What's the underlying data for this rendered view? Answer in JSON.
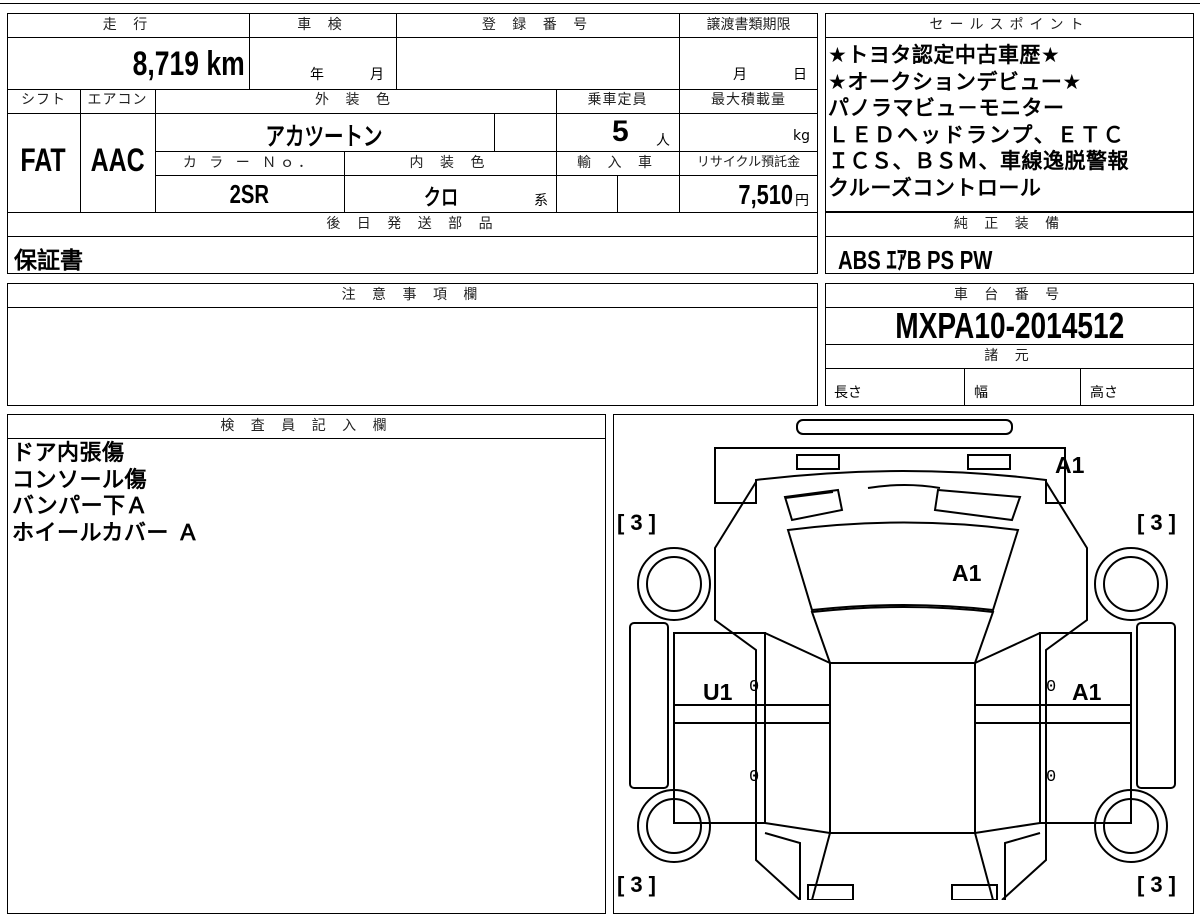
{
  "top_table": {
    "mileage": {
      "header": "走 行",
      "value": "8,719 km"
    },
    "inspection": {
      "header": "車 検",
      "year_unit": "年",
      "month_unit": "月"
    },
    "registration_no": {
      "header": "登 録 番 号"
    },
    "transfer_deadline": {
      "header": "譲渡書類期限",
      "month_unit": "月",
      "day_unit": "日"
    },
    "shift": {
      "header": "シフト",
      "value": "FAT"
    },
    "aircon": {
      "header": "エアコン",
      "value": "AAC"
    },
    "exterior_color": {
      "header": "外 装 色",
      "value": "アカツートン"
    },
    "capacity": {
      "header": "乗車定員",
      "value": "5",
      "unit": "人"
    },
    "max_load": {
      "header": "最大積載量",
      "unit": "kg"
    },
    "color_no": {
      "header": "カ ラ ー Ｎｏ．",
      "value": "2SR"
    },
    "interior_color": {
      "header": "内 装 色",
      "value": "クロ",
      "unit": "系"
    },
    "import": {
      "header": "輸 入 車"
    },
    "recycle_fee": {
      "header": "リサイクル預託金",
      "value": "7,510",
      "unit": "円"
    },
    "later_parts": {
      "header": "後 日 発 送 部 品",
      "value": "保証書"
    }
  },
  "sales_points": {
    "header": "セールスポイント",
    "lines": [
      "★トヨタ認定中古車歴★",
      "★オークションデビュー★",
      "パノラマビュ－モニター",
      "ＬＥＤヘッドランプ、ＥＴＣ",
      "ＩＣＳ、ＢＳＭ、車線逸脱警報",
      "クルーズコントロール"
    ]
  },
  "genuine_equipment": {
    "header": "純 正 装 備",
    "value": "ABS ｴｱB PS PW"
  },
  "notes": {
    "header": "注 意 事 項 欄"
  },
  "chassis": {
    "header": "車 台 番 号",
    "value": "MXPA10-2014512"
  },
  "specs": {
    "header": "諸 元",
    "length": "長さ",
    "width": "幅",
    "height": "高さ"
  },
  "inspector": {
    "header": "検 査 員 記 入 欄",
    "lines": [
      "ドア内張傷",
      "コンソール傷",
      "バンパー下Ａ",
      "ホイールカバー Ａ"
    ]
  },
  "diagram_marks": {
    "rear_bumper": "A1",
    "roof": "A1",
    "left_door": "U1",
    "right_door": "A1",
    "tread": "3",
    "zero": "0"
  }
}
